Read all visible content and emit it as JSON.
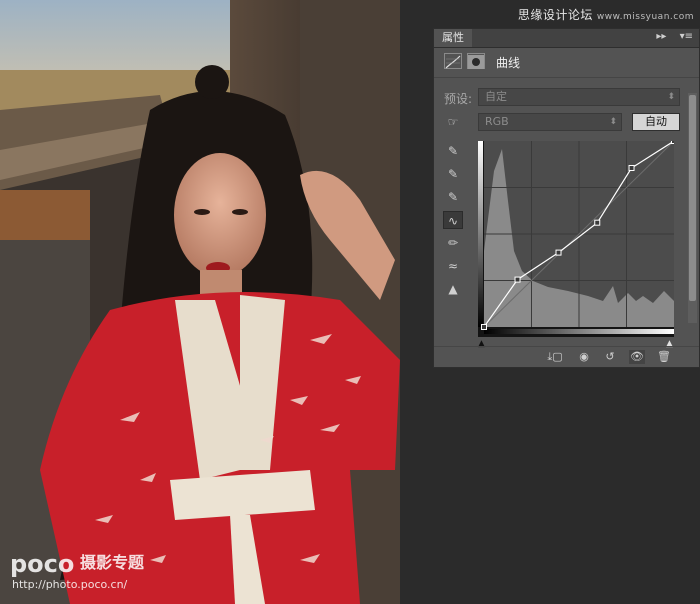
{
  "watermark": {
    "site": "思缘设计论坛",
    "url": "www.missyuan.com"
  },
  "photo_watermark": {
    "brand": "poco",
    "title": "摄影专题",
    "url": "http://photo.poco.cn/"
  },
  "panel": {
    "tab_label": "属性",
    "title": "曲线",
    "preset_label": "预设:",
    "preset_value": "自定",
    "channel_value": "RGB",
    "auto_button": "自动"
  },
  "colors": {
    "panel_bg": "#535353",
    "dark_bg": "#2b2b2b",
    "dress_red": "#c8202a"
  },
  "curve": {
    "input_range": [
      0,
      255
    ],
    "points": [
      [
        0,
        0
      ],
      [
        45,
        65
      ],
      [
        100,
        102
      ],
      [
        152,
        143
      ],
      [
        198,
        218
      ],
      [
        255,
        255
      ]
    ]
  }
}
